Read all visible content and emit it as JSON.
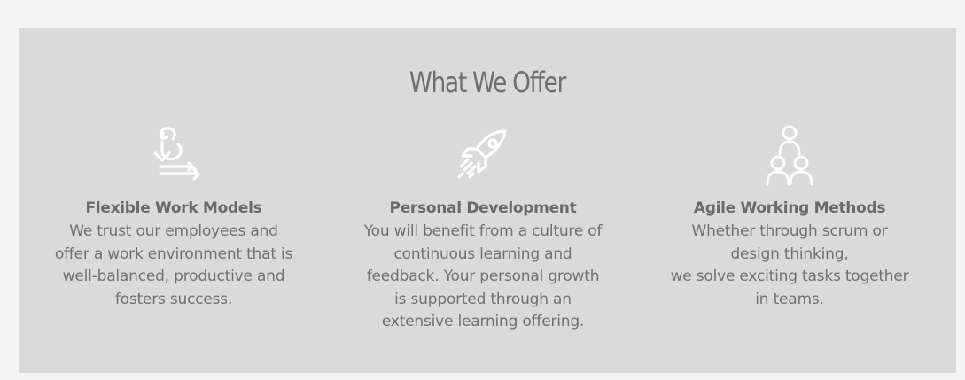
{
  "section": {
    "title": "What We Offer"
  },
  "features": [
    {
      "icon": "cycle-arrows-icon",
      "title": "Flexible Work Models",
      "lines": [
        "We trust our employees and",
        "offer a work environment that is",
        "well-balanced, productive and",
        "fosters success."
      ]
    },
    {
      "icon": "rocket-icon",
      "title": "Personal Development",
      "lines": [
        "You will benefit from a culture of",
        "continuous learning and",
        "feedback. Your personal growth",
        "is supported through an",
        "extensive learning offering."
      ]
    },
    {
      "icon": "team-icon",
      "title": "Agile Working Methods",
      "lines": [
        "Whether through scrum or",
        "design thinking,",
        "we solve exciting tasks together",
        "in teams."
      ]
    }
  ],
  "colors": {
    "page_background": "#f4f4f4",
    "panel_background": "#dadada",
    "text": "#6f6f6f",
    "icon": "#ffffff"
  }
}
